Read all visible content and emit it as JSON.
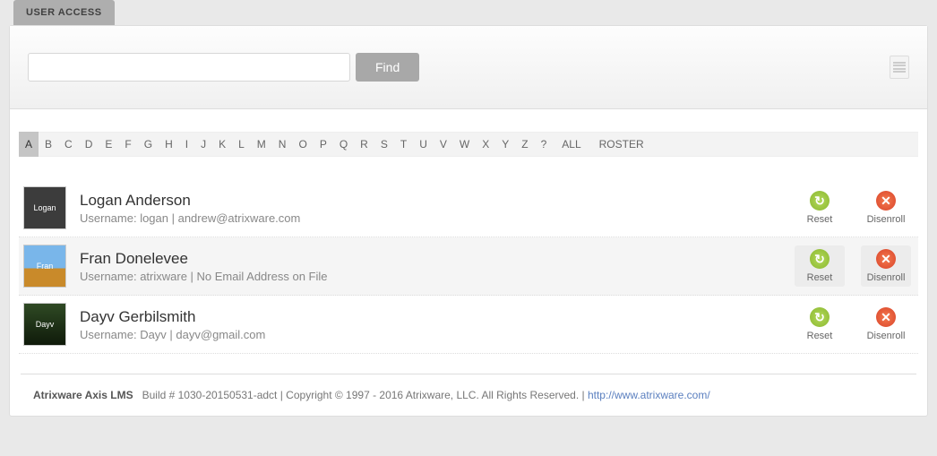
{
  "tabs": {
    "active": "USER ACCESS"
  },
  "search": {
    "value": "",
    "find_label": "Find"
  },
  "alphaBar": {
    "letters": [
      "A",
      "B",
      "C",
      "D",
      "E",
      "F",
      "G",
      "H",
      "I",
      "J",
      "K",
      "L",
      "M",
      "N",
      "O",
      "P",
      "Q",
      "R",
      "S",
      "T",
      "U",
      "V",
      "W",
      "X",
      "Y",
      "Z",
      "?"
    ],
    "all_label": "ALL",
    "roster_label": "ROSTER",
    "active": "A"
  },
  "actions": {
    "reset": "Reset",
    "disenroll": "Disenroll"
  },
  "users": [
    {
      "name": "Logan Anderson",
      "meta": "Username: logan | andrew@atrixware.com",
      "avatar_label": "Logan",
      "avatar_bg": "#3c3c3c",
      "selected": false
    },
    {
      "name": "Fran Donelevee",
      "meta": "Username: atrixware | No Email Address on File",
      "avatar_label": "Fran",
      "avatar_bg": "linear-gradient(#79b6ea 55%, #c98a2a 55%)",
      "selected": true
    },
    {
      "name": "Dayv Gerbilsmith",
      "meta": "Username: Dayv | dayv@gmail.com",
      "avatar_label": "Dayv",
      "avatar_bg": "linear-gradient(#2f4a24,#0f1a0a)",
      "selected": false
    }
  ],
  "footer": {
    "product": "Atrixware Axis LMS",
    "build": "Build # 1030-20150531-adct | Copyright © 1997 - 2016 Atrixware, LLC. All Rights Reserved. | ",
    "link": "http://www.atrixware.com/"
  }
}
